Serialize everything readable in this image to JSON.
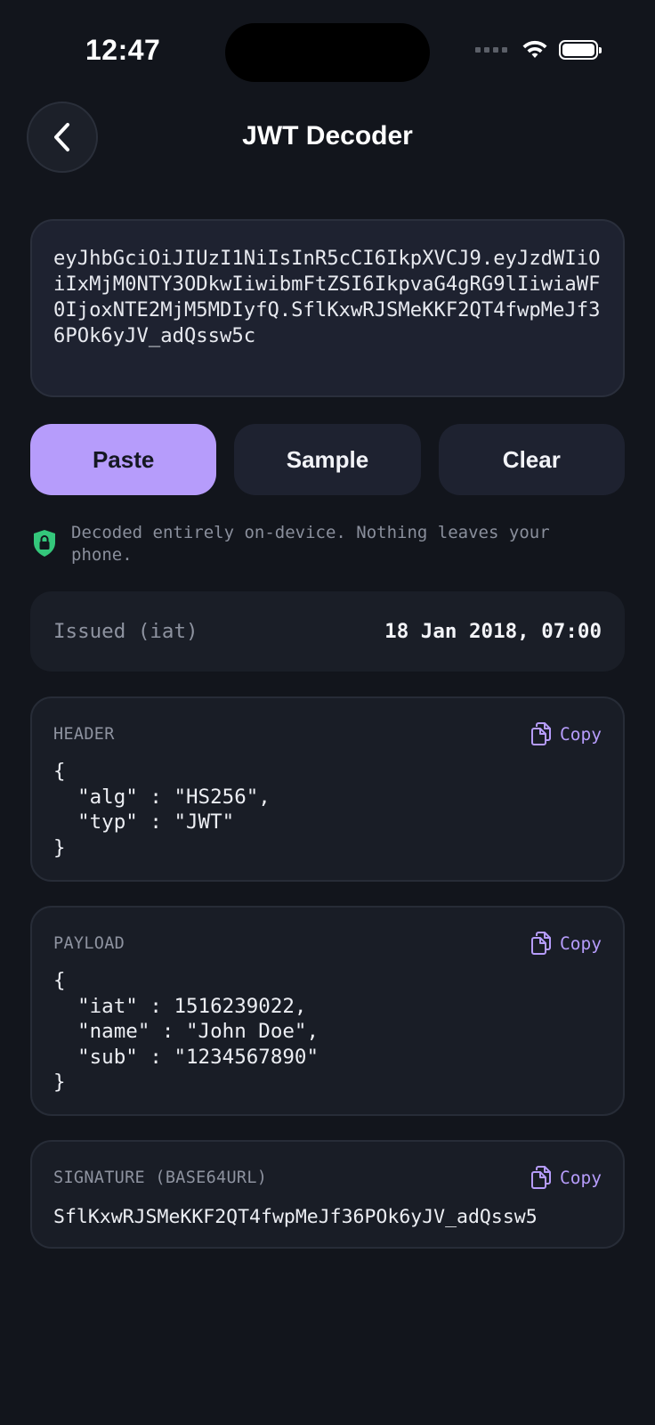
{
  "status": {
    "time": "12:47"
  },
  "nav": {
    "title": "JWT Decoder"
  },
  "token": {
    "value": "eyJhbGciOiJIUzI1NiIsInR5cCI6IkpXVCJ9.eyJzdWIiOiIxMjM0NTY3ODkwIiwibmFtZSI6IkpvaG4gRG9lIiwiaWF0IjoxNTE2MjM5MDIyfQ.SflKxwRJSMeKKF2QT4fwpMeJf36POk6yJV_adQssw5c"
  },
  "actions": {
    "paste": "Paste",
    "sample": "Sample",
    "clear": "Clear"
  },
  "note": {
    "text": "Decoded entirely on-device. Nothing leaves your phone."
  },
  "issued": {
    "label": "Issued (iat)",
    "value": "18 Jan 2018, 07:00"
  },
  "header": {
    "label": "HEADER",
    "copy": "Copy",
    "json": "{\n  \"alg\" : \"HS256\",\n  \"typ\" : \"JWT\"\n}"
  },
  "payload": {
    "label": "PAYLOAD",
    "copy": "Copy",
    "json": "{\n  \"iat\" : 1516239022,\n  \"name\" : \"John Doe\",\n  \"sub\" : \"1234567890\"\n}"
  },
  "signature": {
    "label": "SIGNATURE (BASE64URL)",
    "copy": "Copy",
    "value": "SflKxwRJSMeKKF2QT4fwpMeJf36POk6yJV_adQssw5"
  },
  "colors": {
    "accent": "#b69cfb",
    "background": "#12151c",
    "shield": "#34c77b"
  },
  "icons": {
    "back": "chevron-left-icon",
    "copy": "copy-icon",
    "shield": "lock-shield-icon"
  }
}
